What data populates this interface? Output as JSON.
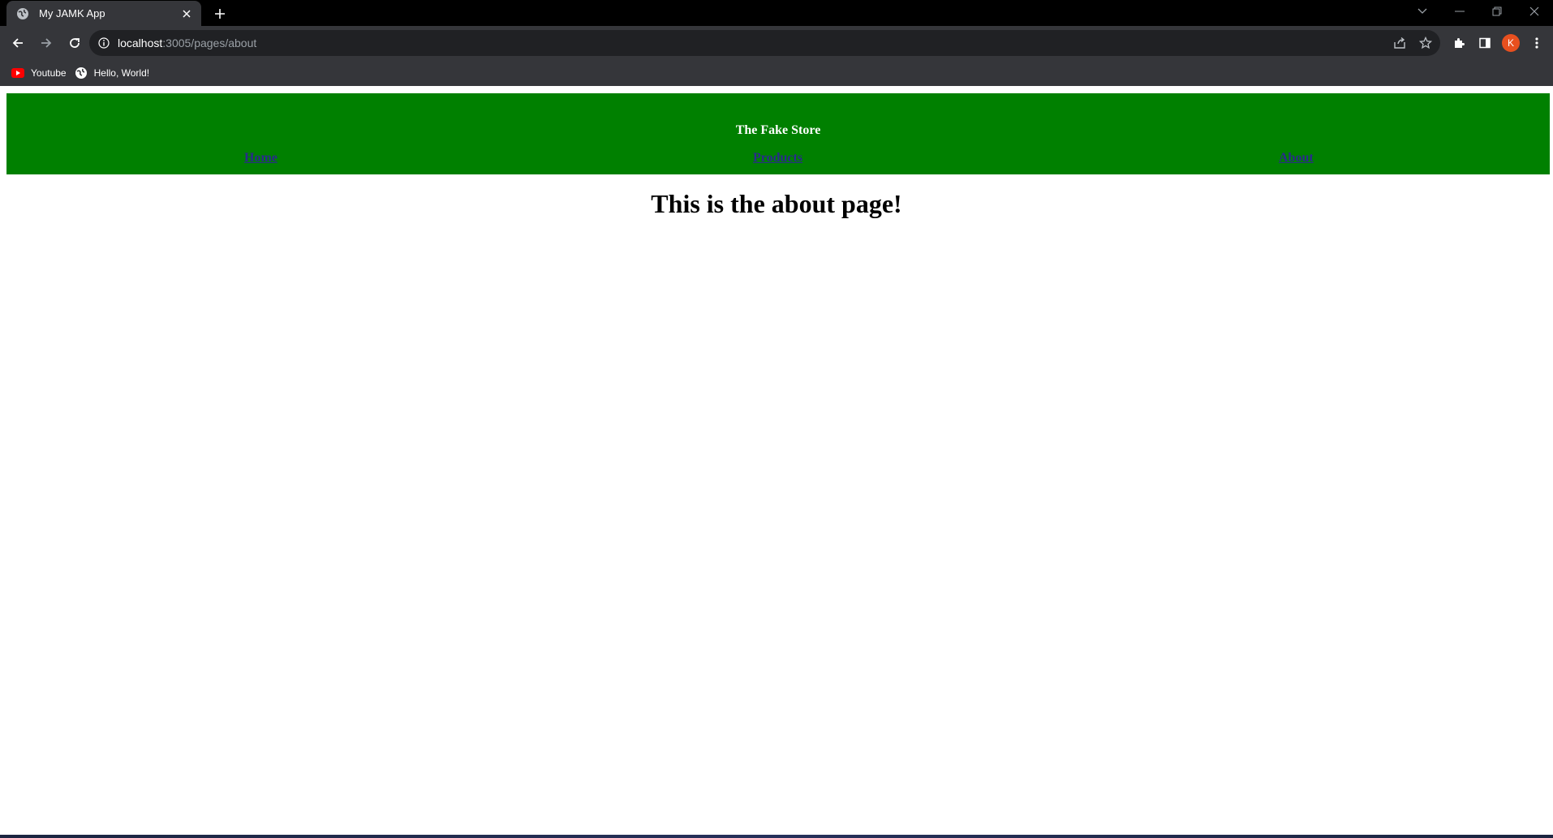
{
  "browser": {
    "tab": {
      "title": "My JAMK App"
    },
    "address": {
      "host": "localhost",
      "rest": ":3005/pages/about"
    },
    "profile_initial": "K",
    "bookmarks": [
      {
        "label": "Youtube",
        "icon": "youtube-icon"
      },
      {
        "label": "Hello, World!",
        "icon": "globe-icon"
      }
    ]
  },
  "page": {
    "header": {
      "title": "The Fake Store",
      "background": "#008000"
    },
    "nav": {
      "home": "Home",
      "products": "Products",
      "about": "About"
    },
    "heading": "This is the about page!"
  }
}
